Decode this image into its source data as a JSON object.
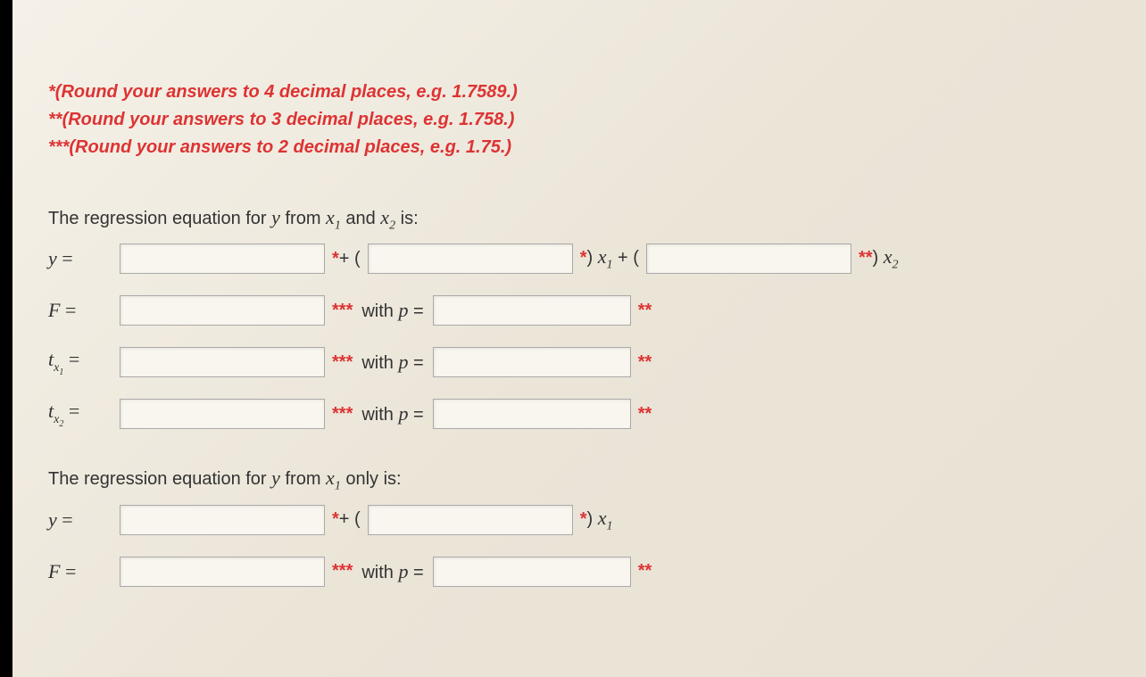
{
  "instructions": {
    "line1": "*(Round your answers to 4 decimal places, e.g. 1.7589.)",
    "line2": "**(Round your answers to 3 decimal places, e.g. 1.758.)",
    "line3": "***(Round your answers to 2 decimal places, e.g. 1.75.)"
  },
  "section1": {
    "prompt_pre": "The regression equation for ",
    "prompt_y": "y",
    "prompt_mid1": " from ",
    "prompt_x1": "x",
    "prompt_x1sub": "1",
    "prompt_mid2": " and ",
    "prompt_x2": "x",
    "prompt_x2sub": "2",
    "prompt_post": " is:",
    "y_label": "y",
    "eq": " =",
    "after_b0": "*+ (",
    "after_b1_pre": "*) ",
    "after_b1_x": "x",
    "after_b1_sub": "1",
    "after_b1_post": " + (",
    "after_b2_pre": "**) ",
    "after_b2_x": "x",
    "after_b2_sub": "2",
    "F_label": "F",
    "tx1_label": "t",
    "tx1_sub": "x",
    "tx1_subsub": "1",
    "tx2_label": "t",
    "tx2_sub": "x",
    "tx2_subsub": "2",
    "triple": "***",
    "withp": " with ",
    "p": "p",
    "dbl": "**"
  },
  "section2": {
    "prompt_pre": "The regression equation for ",
    "prompt_y": "y",
    "prompt_mid1": " from ",
    "prompt_x1": "x",
    "prompt_x1sub": "1",
    "prompt_post": " only is:",
    "y_label": "y",
    "eq": " =",
    "after_b0": "*+ (",
    "after_b1_pre": "*) ",
    "after_b1_x": "x",
    "after_b1_sub": "1",
    "F_label": "F",
    "triple": "***",
    "withp": " with ",
    "p": "p",
    "dbl": "**"
  }
}
